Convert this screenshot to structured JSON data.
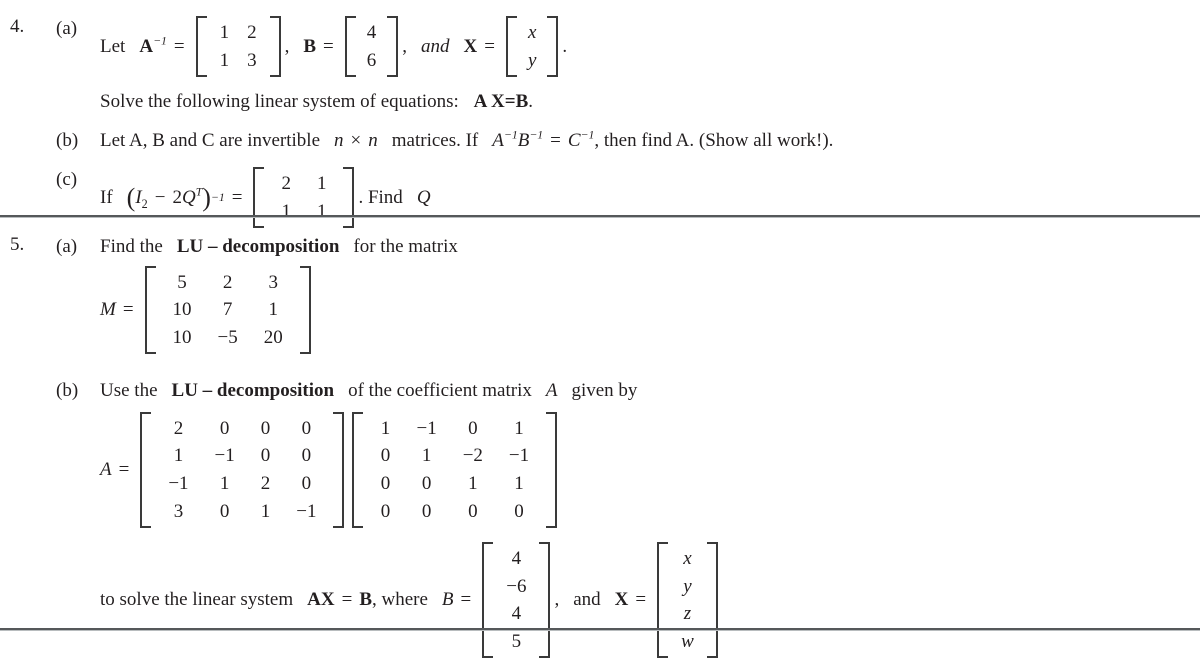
{
  "document": {
    "type": "math-exam-worksheet",
    "problems": [
      {
        "number": "4.",
        "parts": [
          {
            "label": "(a)",
            "lead_text": "Let",
            "symbol_A": "A",
            "exp_A": "−1",
            "eq": "=",
            "matrix_A": {
              "rows": 2,
              "cols": 2,
              "values": [
                "1",
                "2",
                "1",
                "3"
              ]
            },
            "comma1": ",",
            "symbol_B": "B",
            "eq2": "=",
            "matrix_B": {
              "rows": 2,
              "cols": 1,
              "values": [
                "4",
                "6"
              ]
            },
            "comma2": ",",
            "and_word": "and",
            "symbol_X": "X",
            "eq3": "=",
            "matrix_X": {
              "rows": 2,
              "cols": 1,
              "values": [
                "x",
                "y"
              ]
            },
            "period": ".",
            "continuation": "Solve the following linear system of equations:",
            "continuation_math": "A X=B",
            "continuation_period": "."
          },
          {
            "label": "(b)",
            "text_1": "Let A, B and C are invertible",
            "var_n1": "n",
            "times": "×",
            "var_n2": "n",
            "text_2": "matrices. If",
            "expr_A": "A",
            "expr_A_exp": "−1",
            "expr_B": "B",
            "expr_B_exp": "−1",
            "expr_eq": "=",
            "expr_C": "C",
            "expr_C_exp": "−1",
            "text_3": ", then find A. (Show all work!)."
          },
          {
            "label": "(c)",
            "text_1": "If",
            "paren_open": "(",
            "sym_I": "I",
            "sub_I": "2",
            "minus": "−",
            "coef": "2",
            "sym_Q": "Q",
            "sup_T": "T",
            "paren_close": ")",
            "paren_exp": "−1",
            "eq": "=",
            "matrix": {
              "rows": 2,
              "cols": 2,
              "values": [
                "2",
                "1",
                "1",
                "1"
              ]
            },
            "text_2": ". Find",
            "find_var": "Q"
          }
        ]
      },
      {
        "number": "5.",
        "parts": [
          {
            "label": "(a)",
            "text_pre": "Find the",
            "bold_term": "LU – decomposition",
            "text_post": "for the matrix",
            "matrix_label": "M",
            "eq": "=",
            "matrix_M": {
              "rows": 3,
              "cols": 3,
              "values": [
                "5",
                "2",
                "3",
                "10",
                "7",
                "1",
                "10",
                "−5",
                "20"
              ]
            }
          },
          {
            "label": "(b)",
            "text_pre": "Use the",
            "bold_term": "LU – decomposition",
            "text_mid": "of the coefficient matrix",
            "var_A": "A",
            "text_post": "given by",
            "matrix_label": "A",
            "eq": "=",
            "matrix_L": {
              "rows": 4,
              "cols": 4,
              "values": [
                "2",
                "0",
                "0",
                "0",
                "1",
                "−1",
                "0",
                "0",
                "−1",
                "1",
                "2",
                "0",
                "3",
                "0",
                "1",
                "−1"
              ]
            },
            "matrix_U": {
              "rows": 4,
              "cols": 4,
              "values": [
                "1",
                "−1",
                "0",
                "1",
                "0",
                "1",
                "−2",
                "−1",
                "0",
                "0",
                "1",
                "1",
                "0",
                "0",
                "0",
                "0"
              ]
            },
            "tail_text_1": "to solve the linear system",
            "tail_bold_AX": "AX",
            "tail_eq": "=",
            "tail_bold_B": "B",
            "tail_text_2": ", where",
            "tail_var_B": "B",
            "tail_eq2": "=",
            "matrix_B": {
              "rows": 4,
              "cols": 1,
              "values": [
                "4",
                "−6",
                "4",
                "5"
              ]
            },
            "tail_comma": ",",
            "tail_and": "and",
            "tail_bold_X": "X",
            "tail_eq3": "=",
            "matrix_X": {
              "rows": 4,
              "cols": 1,
              "values": [
                "x",
                "y",
                "z",
                "w"
              ]
            }
          }
        ]
      }
    ],
    "rules": {
      "count": 2,
      "color": "#55585a"
    }
  }
}
